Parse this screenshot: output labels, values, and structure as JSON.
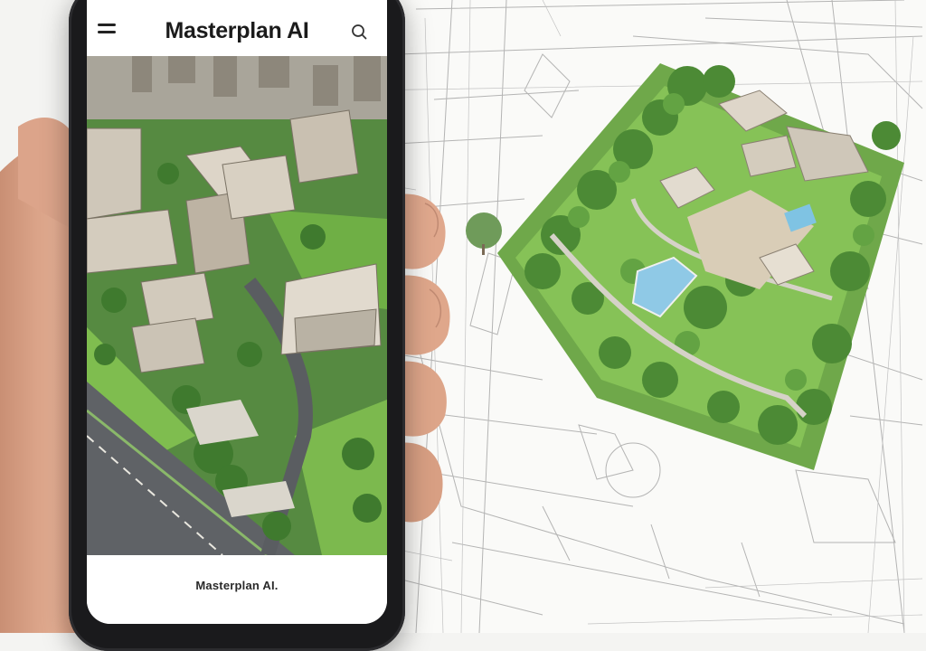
{
  "app": {
    "title": "Masterplan AI",
    "footer_label": "Masterplan AI."
  },
  "icons": {
    "menu": "hamburger-menu-icon",
    "search": "search-icon"
  },
  "colors": {
    "greenery": "#5c9b3c",
    "lawn": "#7fbd4f",
    "pool": "#8fc9e6",
    "asphalt": "#5f6266",
    "building": "#cfc7b9",
    "blueprint_line": "#9a9a9a",
    "phone_body": "#1a1a1c"
  }
}
